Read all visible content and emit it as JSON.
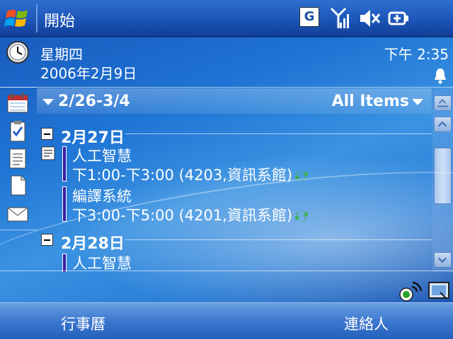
{
  "titlebar": {
    "title": "開始",
    "tray": {
      "gprs_label": "G",
      "icons": [
        "signal-icon",
        "volume-muted-icon",
        "battery-icon"
      ]
    }
  },
  "today": {
    "day_of_week": "星期四",
    "date": "2006年2月9日",
    "time": "下午 2:35"
  },
  "calendar": {
    "range": "2/26-3/4",
    "filter": "All Items",
    "days": [
      {
        "label": "2月27日",
        "appointments": [
          {
            "title": "人工智慧",
            "time": "下1:00-下3:00 (4203,資訊系館)"
          },
          {
            "title": "編譯系統",
            "time": "下3:00-下5:00 (4201,資訊系館)"
          }
        ]
      },
      {
        "label": "2月28日",
        "appointments": [
          {
            "title": "人工智慧"
          }
        ]
      }
    ]
  },
  "softkeys": {
    "left": "行事曆",
    "right": "連絡人"
  },
  "colors": {
    "titlebar": "#1c56b8",
    "softkeys": "#3c78cf",
    "appointment_bar": "#3a1aa8"
  }
}
